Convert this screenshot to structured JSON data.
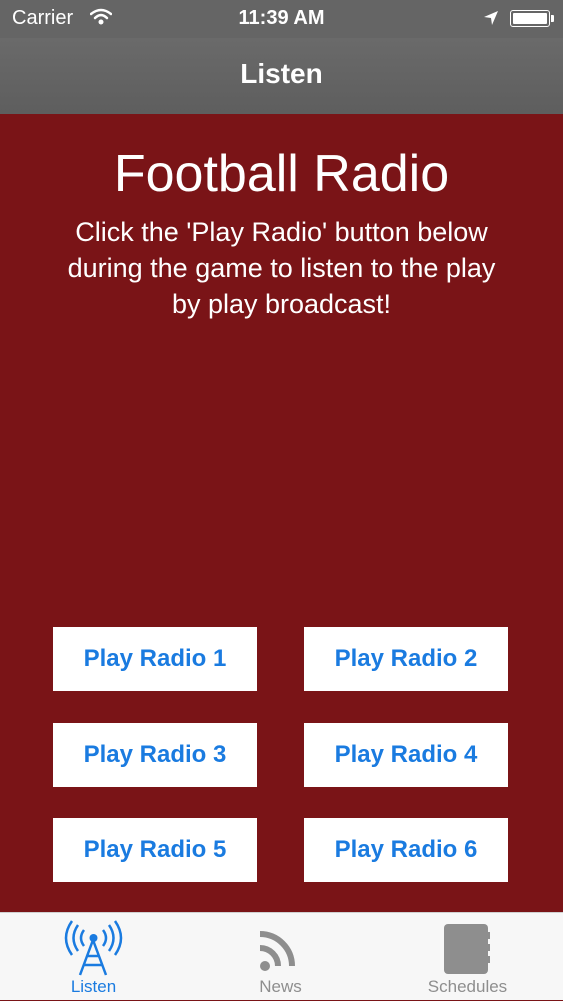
{
  "status_bar": {
    "carrier": "Carrier",
    "time": "11:39 AM",
    "icons": [
      "wifi-icon",
      "location-arrow-icon",
      "battery-icon"
    ]
  },
  "nav": {
    "title": "Listen"
  },
  "main": {
    "heading": "Football Radio",
    "intro": "Click the 'Play Radio' button below during the game to listen to the play by play broadcast!"
  },
  "buttons": [
    {
      "label": "Play Radio 1"
    },
    {
      "label": "Play Radio 2"
    },
    {
      "label": "Play Radio 3"
    },
    {
      "label": "Play Radio 4"
    },
    {
      "label": "Play Radio 5"
    },
    {
      "label": "Play Radio 6"
    }
  ],
  "tabs": [
    {
      "label": "Listen",
      "icon": "radio-tower-icon",
      "active": true
    },
    {
      "label": "News",
      "icon": "rss-icon",
      "active": false
    },
    {
      "label": "Schedules",
      "icon": "notebook-icon",
      "active": false
    }
  ],
  "colors": {
    "background": "#7a1417",
    "nav_bar": "#656565",
    "accent": "#1a7be0",
    "button_bg": "#ffffff",
    "tab_inactive": "#8e8e8e"
  }
}
